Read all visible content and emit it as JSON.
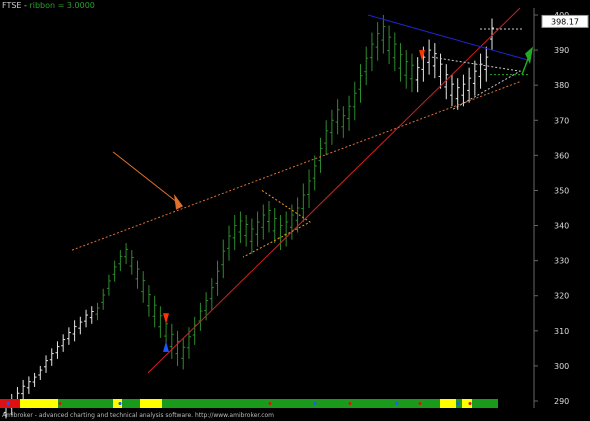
{
  "header": {
    "symbol": "FTSE",
    "indicator": "ribbon = 3.0000"
  },
  "footer": {
    "text": "Amibroker - advanced charting and technical analysis software. http://www.amibroker.com"
  },
  "price_label": "398.17",
  "colors": {
    "background": "#000000",
    "up_bar": "#2e8b2e",
    "white_bar": "#e6e6e6",
    "trend_red": "#cc2222",
    "blue_line": "#2222cc",
    "orange": "#e07030",
    "ribbon_green": "#1a9a1a",
    "ribbon_yellow": "#ffff00",
    "ribbon_red": "#dd1111"
  },
  "chart_data": {
    "type": "ohlc",
    "title": "FTSE",
    "ylim": [
      288,
      402
    ],
    "y_ticks": [
      290,
      300,
      310,
      320,
      330,
      340,
      350,
      360,
      370,
      380,
      390,
      400
    ],
    "series": [
      {
        "color": "white",
        "bars": [
          [
            285,
            290
          ],
          [
            286,
            292
          ],
          [
            288,
            294
          ],
          [
            290,
            296
          ],
          [
            292,
            297
          ],
          [
            294,
            298
          ],
          [
            296,
            300
          ],
          [
            298,
            303
          ],
          [
            300,
            305
          ],
          [
            302,
            307
          ],
          [
            304,
            309
          ],
          [
            306,
            311
          ],
          [
            307,
            313
          ],
          [
            309,
            314
          ],
          [
            311,
            316
          ],
          [
            312,
            317
          ]
        ]
      },
      {
        "color": "green",
        "bars": [
          [
            313,
            318
          ],
          [
            316,
            322
          ],
          [
            320,
            326
          ],
          [
            324,
            330
          ],
          [
            327,
            333
          ],
          [
            329,
            335
          ],
          [
            326,
            333
          ],
          [
            322,
            330
          ],
          [
            318,
            327
          ],
          [
            314,
            323
          ],
          [
            311,
            320
          ],
          [
            308,
            317
          ],
          [
            305,
            315
          ],
          [
            302,
            312
          ],
          [
            300,
            310
          ],
          [
            299,
            308
          ],
          [
            302,
            311
          ],
          [
            306,
            314
          ],
          [
            310,
            318
          ],
          [
            313,
            321
          ]
        ]
      },
      {
        "color": "green2",
        "bars": [
          [
            316,
            325
          ],
          [
            320,
            330
          ],
          [
            325,
            336
          ],
          [
            330,
            340
          ],
          [
            333,
            343
          ],
          [
            335,
            344
          ],
          [
            334,
            343
          ],
          [
            332,
            342
          ],
          [
            334,
            344
          ],
          [
            336,
            346
          ],
          [
            338,
            347
          ],
          [
            335,
            345
          ],
          [
            333,
            343
          ],
          [
            334,
            344
          ],
          [
            336,
            346
          ],
          [
            338,
            348
          ],
          [
            341,
            352
          ],
          [
            345,
            356
          ],
          [
            350,
            360
          ],
          [
            355,
            365
          ],
          [
            360,
            370
          ],
          [
            363,
            373
          ],
          [
            366,
            376
          ],
          [
            365,
            374
          ],
          [
            367,
            377
          ],
          [
            370,
            381
          ],
          [
            375,
            386
          ],
          [
            380,
            391
          ],
          [
            384,
            395
          ],
          [
            387,
            398
          ],
          [
            389,
            400
          ],
          [
            386,
            397
          ],
          [
            384,
            395
          ],
          [
            381,
            392
          ],
          [
            379,
            390
          ],
          [
            378,
            389
          ]
        ]
      },
      {
        "color": "white2",
        "bars": [
          [
            378,
            388
          ],
          [
            381,
            391
          ],
          [
            383,
            393
          ],
          [
            382,
            392
          ],
          [
            379,
            389
          ],
          [
            376,
            386
          ],
          [
            374,
            383
          ],
          [
            373,
            382
          ],
          [
            374,
            383
          ],
          [
            375,
            385
          ],
          [
            377,
            387
          ],
          [
            379,
            389
          ],
          [
            381,
            391
          ],
          [
            390,
            399
          ]
        ]
      }
    ],
    "annotations": {
      "price_marker": 398.17
    }
  }
}
